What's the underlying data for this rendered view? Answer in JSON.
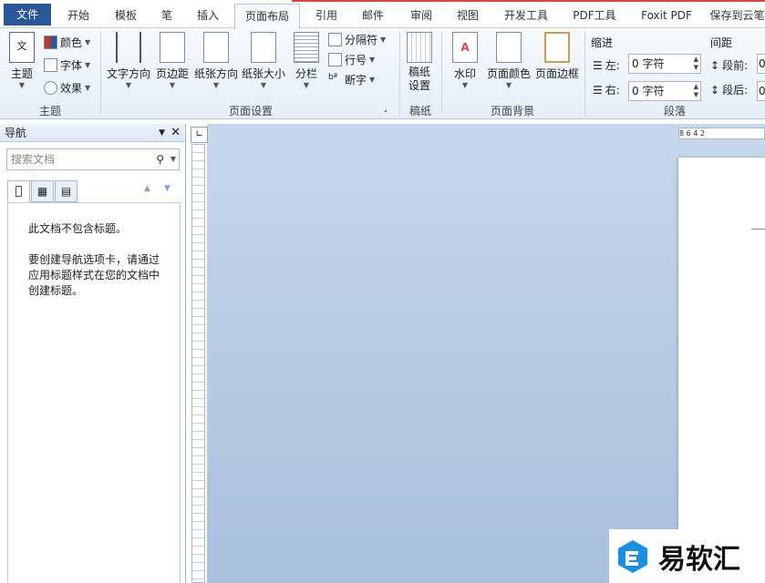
{
  "tabs": [
    "文件",
    "开始",
    "模板",
    "笔",
    "插入",
    "页面布局",
    "引用",
    "邮件",
    "审阅",
    "视图",
    "开发工具",
    "PDF工具",
    "Foxit PDF",
    "保存到云笔"
  ],
  "ribbon": {
    "theme": {
      "main": "主题",
      "colors": "颜色",
      "fonts": "字体",
      "effects": "效果",
      "group": "主题"
    },
    "page_setup": {
      "text_dir": "文字方向",
      "margins": "页边距",
      "orientation": "纸张方向",
      "size": "纸张大小",
      "columns": "分栏",
      "breaks": "分隔符",
      "line_numbers": "行号",
      "hyphenation": "断字",
      "group": "页面设置"
    },
    "draft": {
      "settings": "稿纸\n设置",
      "group": "稿纸"
    },
    "background": {
      "watermark": "水印",
      "page_color": "页面颜色",
      "page_border": "页面边框",
      "group": "页面背景"
    },
    "paragraph": {
      "indent": "缩进",
      "left": "左:",
      "right": "右:",
      "left_val": "0 字符",
      "right_val": "0 字符",
      "spacing": "间距",
      "before": "段前:",
      "after": "段后:",
      "before_val": "0",
      "after_val": "0",
      "group": "段落"
    }
  },
  "nav": {
    "title": "导航",
    "search_placeholder": "搜索文档",
    "empty_title": "此文档不包含标题。",
    "empty_hint": "要创建导航选项卡，请通过应用标题样式在您的文档中创建标题。"
  },
  "ruler_h": "8   6   4   2",
  "watermark_text": "易软汇",
  "colors": {
    "file_tab": "#2b5797",
    "accent_red": "#d84747",
    "doc_bg": "#b8cbe4"
  }
}
